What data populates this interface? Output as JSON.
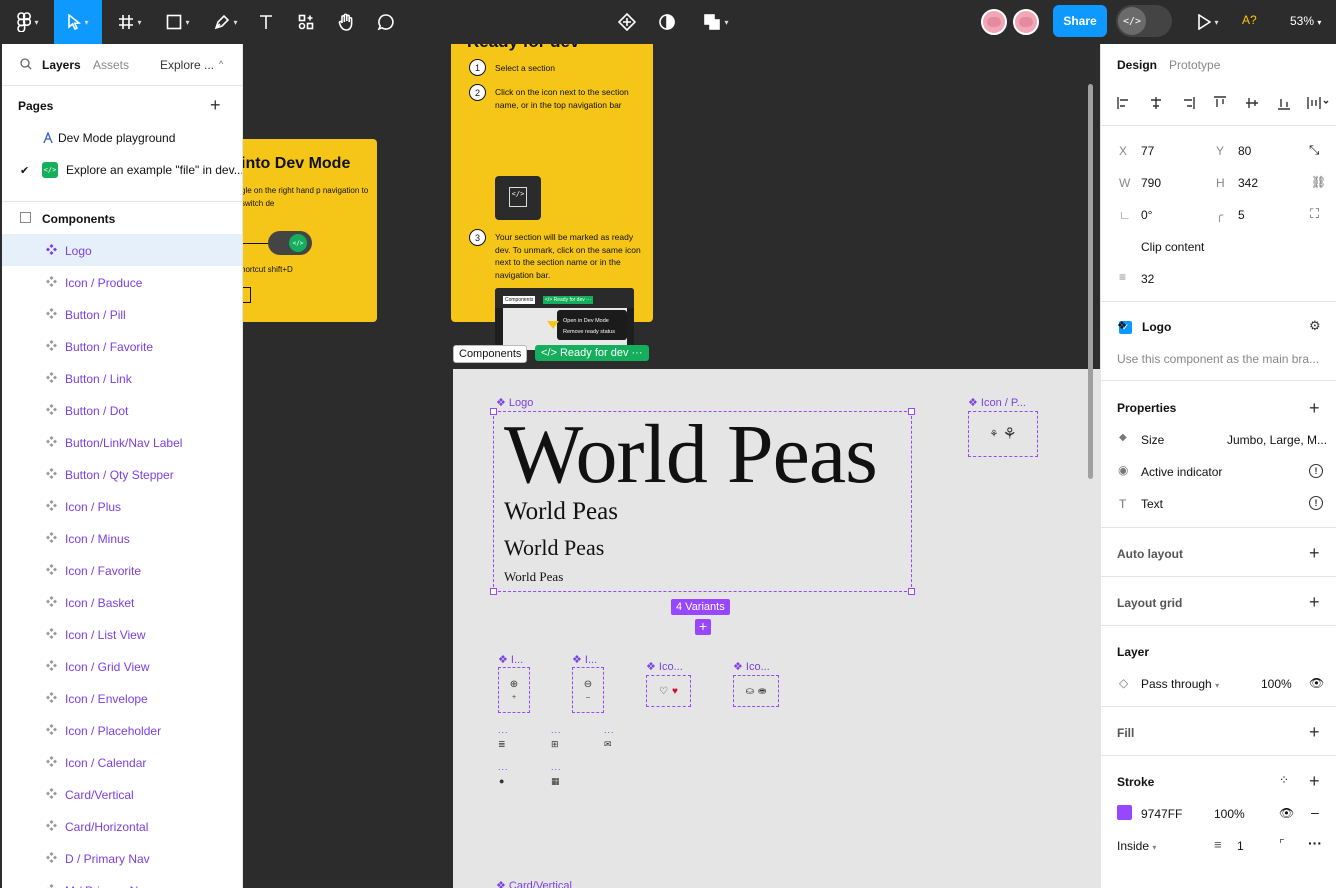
{
  "toolbar": {
    "share_label": "Share",
    "ai_label": "A?",
    "zoom": "53%",
    "devmode_icon": "</>",
    "colors": {
      "accent": "#0d99ff",
      "bg": "#2c2c2c"
    }
  },
  "left_panel": {
    "tabs": {
      "layers": "Layers",
      "assets": "Assets",
      "explore": "Explore ..."
    },
    "pages_header": "Pages",
    "pages": [
      {
        "label": "Dev Mode playground",
        "checked": false
      },
      {
        "label": "Explore an example \"file\" in dev...",
        "checked": true
      }
    ],
    "section_label": "Components",
    "layers": [
      "Logo",
      "Icon / Produce",
      "Button / Pill",
      "Button / Favorite",
      "Button / Link",
      "Button / Dot",
      "Button/Link/Nav Label",
      "Button / Qty Stepper",
      "Icon / Plus",
      "Icon / Minus",
      "Icon / Favorite",
      "Icon / Basket",
      "Icon / List View",
      "Icon / Grid View",
      "Icon / Envelope",
      "Icon / Placeholder",
      "Icon / Calendar",
      "Card/Vertical",
      "Card/Horizontal",
      "D / Primary Nav",
      "M / Primary Nav"
    ]
  },
  "canvas": {
    "ready_card": {
      "title": "Ready for dev",
      "steps": [
        {
          "num": "1",
          "text": "Select a section"
        },
        {
          "num": "2",
          "text": "Click on the icon next to the section name, or in the top navigation bar"
        },
        {
          "num": "3",
          "text": "Your section will be marked as ready dev. To unmark, click on the same icon next to the section name or in the navigation bar."
        }
      ],
      "shot_chip1": "Components",
      "shot_chip2": "</> Ready for dev ···",
      "shot_menu1": "Open in Dev Mode",
      "shot_menu2": "Remove ready status"
    },
    "devmode_card": {
      "title": "into Dev Mode",
      "body": "gle on the right hand p navigation to switch de",
      "shortcut": "hortcut shift+D"
    },
    "section_tag": "Components",
    "ready_tag": "</> Ready for dev ···",
    "logo_label": "❖ Logo",
    "logo_texts": {
      "xl": "World Peas",
      "l": "World Peas",
      "m": "World Peas",
      "s": "World Peas"
    },
    "variants_badge": "4 Variants",
    "icon_produce_label": "❖ Icon / P...",
    "mini_labels": [
      "❖ I...",
      "❖ I...",
      "❖ Ico...",
      "❖ Ico..."
    ],
    "dots": "...",
    "card_vertical_label": "❖ Card/Vertical"
  },
  "right_panel": {
    "tabs": {
      "design": "Design",
      "prototype": "Prototype"
    },
    "geometry_labels": {
      "x": "X",
      "y": "Y",
      "w": "W",
      "h": "H"
    },
    "x": "77",
    "y": "80",
    "w": "790",
    "h": "342",
    "rotation": "0°",
    "radius": "5",
    "clip_content": "Clip content",
    "spacing": "32",
    "component_name": "Logo",
    "component_desc": "Use this component as the main bra...",
    "properties_title": "Properties",
    "properties": [
      {
        "name": "Size",
        "value": "Jumbo, Large, M..."
      },
      {
        "name": "Active indicator",
        "value": ""
      },
      {
        "name": "Text",
        "value": ""
      }
    ],
    "auto_layout": "Auto layout",
    "layout_grid": "Layout grid",
    "layer_title": "Layer",
    "blend_mode": "Pass through",
    "layer_opacity": "100%",
    "fill_title": "Fill",
    "stroke_title": "Stroke",
    "stroke_color": "9747FF",
    "stroke_opacity": "100%",
    "stroke_position": "Inside",
    "stroke_weight": "1",
    "stroke_swatch": "#9747ff"
  }
}
